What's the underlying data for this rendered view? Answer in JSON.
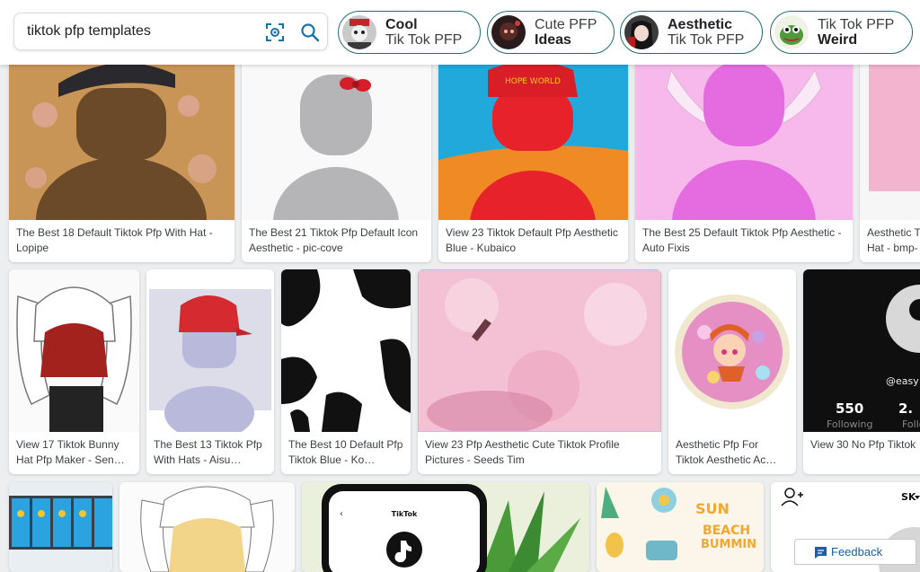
{
  "search": {
    "query": "tiktok pfp templates"
  },
  "chips": [
    {
      "line1": "Cool",
      "line2": "Tik Tok PFP",
      "bold_line": 1
    },
    {
      "line1": "Cute PFP",
      "line2": "Ideas",
      "bold_line": 2
    },
    {
      "line1": "Aesthetic",
      "line2": "Tik Tok PFP",
      "bold_line": 1
    },
    {
      "line1": "Tik Tok PFP",
      "line2": "Weird",
      "bold_line": 2
    }
  ],
  "results": [
    {
      "line1": "The Best 18 Default Tiktok Pfp With Hat -",
      "line2": "Lopipe"
    },
    {
      "line1": "The Best 21 Tiktok Pfp Default Icon",
      "line2": "Aesthetic - pic-cove"
    },
    {
      "line1": "View 23 Tiktok Default Pfp Aesthetic",
      "line2": "Blue - Kubaico"
    },
    {
      "line1": "The Best 25 Default Tiktok Pfp Aesthetic -",
      "line2": "Auto Fixis"
    },
    {
      "line1": "Aesthetic T",
      "line2": "Hat - bmp-"
    },
    {
      "line1": "View 17 Tiktok Bunny",
      "line2": "Hat Pfp Maker - Sen…"
    },
    {
      "line1": "The Best 13 Tiktok Pfp",
      "line2": "With Hats - Aisu…"
    },
    {
      "line1": "The Best 10 Default Pfp",
      "line2": "Tiktok Blue - Ko…"
    },
    {
      "line1": "View 23 Pfp Aesthetic Cute Tiktok Profile",
      "line2": "Pictures - Seeds Tim"
    },
    {
      "line1": "Aesthetic Pfp For",
      "line2": "Tiktok Aesthetic Ac…"
    },
    {
      "line1": "View 30 No Pfp Tiktok",
      "line2": ""
    }
  ],
  "image_text": {
    "hat_text": "HOPE WORLD",
    "followers_count": "550",
    "followers_label": "Following",
    "second_count": "2.",
    "second_label": "Follo",
    "handle": "@easy",
    "phone_title": "TikTok",
    "beach_sun": "SUN",
    "beach_text": "BEACH",
    "beach_text2": "BUMMIN",
    "profile_tag": "SK"
  },
  "feedback": {
    "label": "Feedback"
  }
}
